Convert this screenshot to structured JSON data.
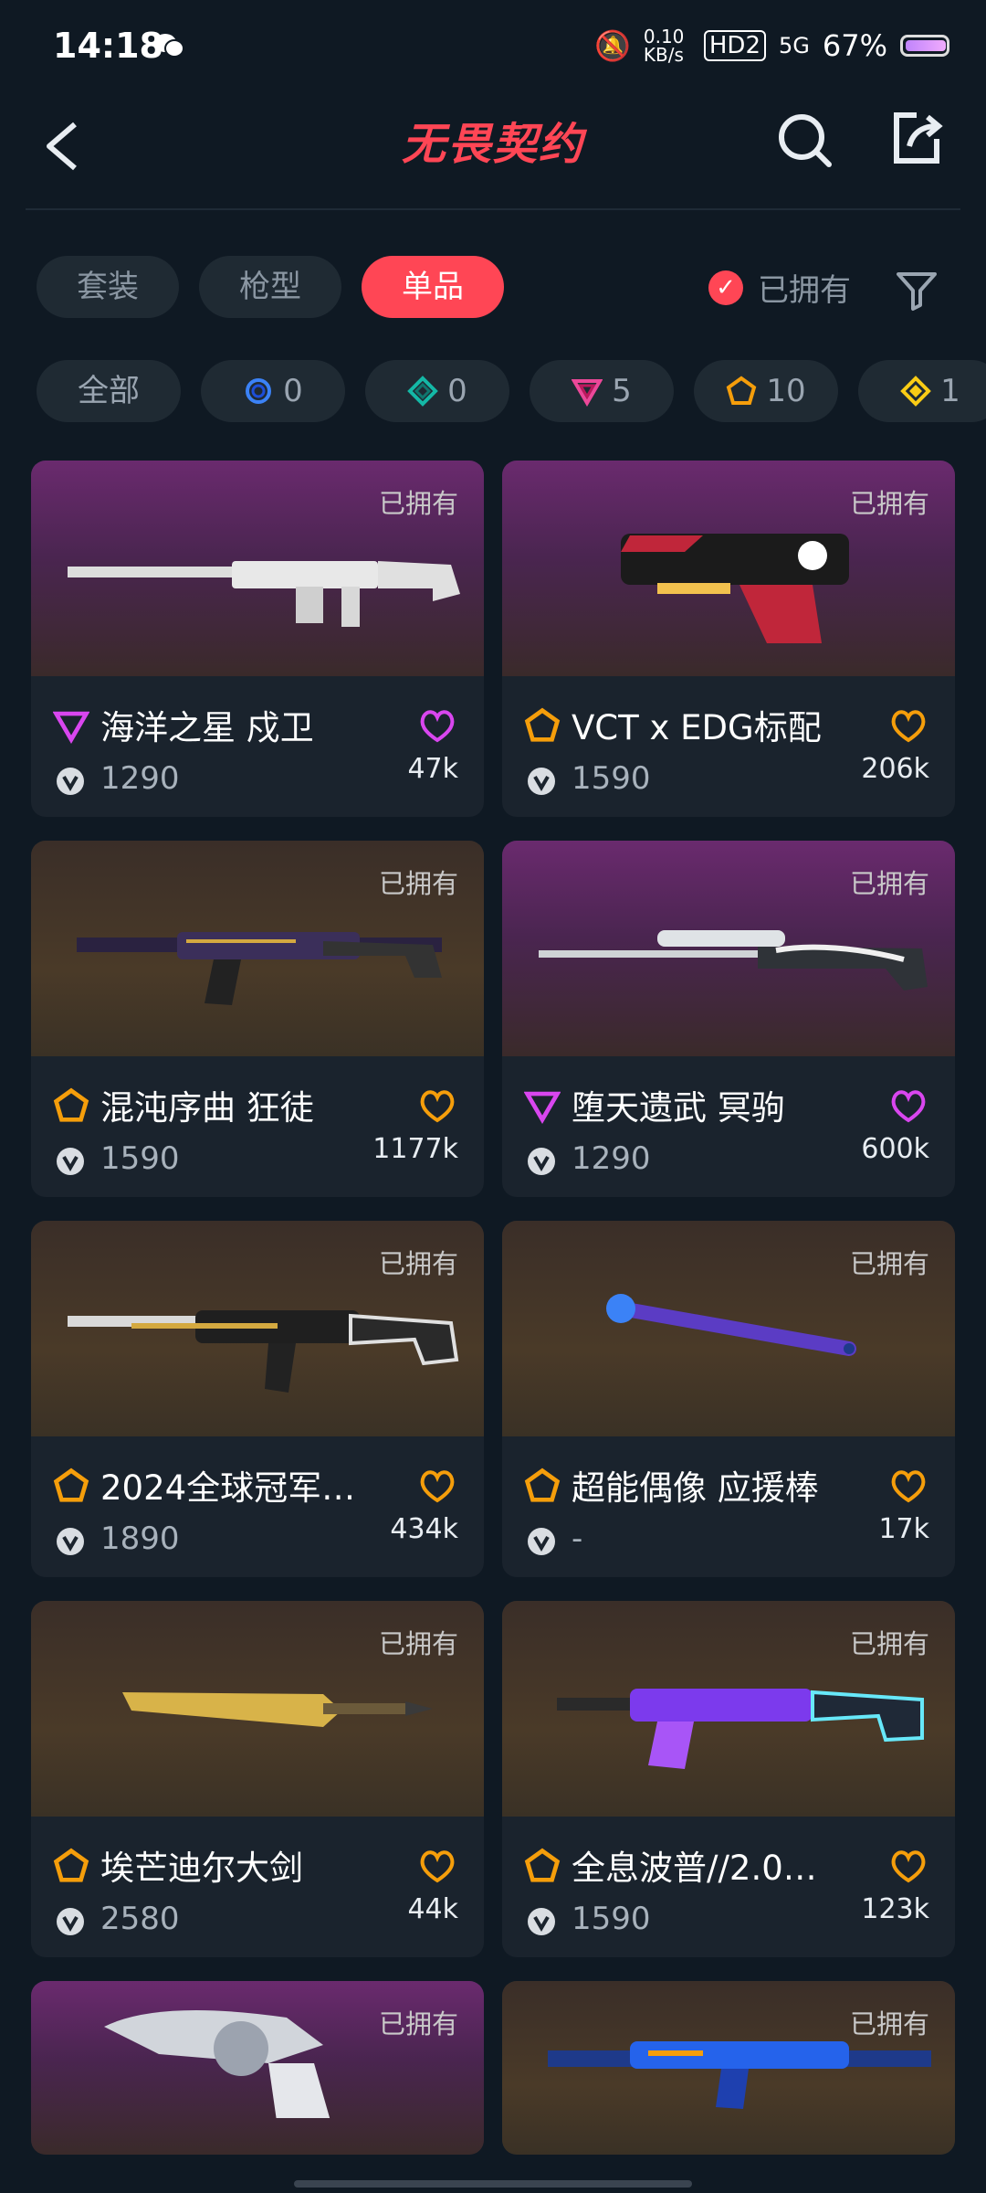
{
  "status_bar": {
    "time": "14:18",
    "net_speed": "0.10 KB/s",
    "hd": "HD2",
    "signal": "5G",
    "battery": "67%"
  },
  "header": {
    "logo_text": "无畏契约"
  },
  "tabs": [
    {
      "label": "套装"
    },
    {
      "label": "枪型"
    },
    {
      "label": "单品",
      "active": true
    }
  ],
  "owned_filter": {
    "label": "已拥有",
    "checked": true
  },
  "tiers": [
    {
      "label": "全部"
    },
    {
      "label": "0",
      "color": "#3b82f6"
    },
    {
      "label": "0",
      "color": "#14b8a6"
    },
    {
      "label": "5",
      "color": "#ec4899"
    },
    {
      "label": "10",
      "color": "#f59e0b"
    },
    {
      "label": "1",
      "color": "#facc15"
    }
  ],
  "items": [
    {
      "owned": "已拥有",
      "name": "海洋之星 戍卫",
      "price": "1290",
      "likes": "47k",
      "tier_color": "#d946ef",
      "bg": "purple"
    },
    {
      "owned": "已拥有",
      "name": "VCT x EDG标配",
      "price": "1590",
      "likes": "206k",
      "tier_color": "#f59e0b",
      "bg": "purple"
    },
    {
      "owned": "已拥有",
      "name": "混沌序曲 狂徒",
      "price": "1590",
      "likes": "1177k",
      "tier_color": "#f59e0b",
      "bg": "gold"
    },
    {
      "owned": "已拥有",
      "name": "堕天遗武 冥驹",
      "price": "1290",
      "likes": "600k",
      "tier_color": "#d946ef",
      "bg": "purple"
    },
    {
      "owned": "已拥有",
      "name": "2024全球冠军…",
      "price": "1890",
      "likes": "434k",
      "tier_color": "#f59e0b",
      "bg": "gold"
    },
    {
      "owned": "已拥有",
      "name": "超能偶像 应援棒",
      "price": "-",
      "likes": "17k",
      "tier_color": "#f59e0b",
      "bg": "gold"
    },
    {
      "owned": "已拥有",
      "name": "埃芒迪尔大剑",
      "price": "2580",
      "likes": "44k",
      "tier_color": "#f59e0b",
      "bg": "gold"
    },
    {
      "owned": "已拥有",
      "name": "全息波普//2.0…",
      "price": "1590",
      "likes": "123k",
      "tier_color": "#f59e0b",
      "bg": "gold"
    },
    {
      "owned": "已拥有",
      "name": "",
      "price": "",
      "likes": "",
      "tier_color": "#d946ef",
      "bg": "purple"
    },
    {
      "owned": "已拥有",
      "name": "",
      "price": "",
      "likes": "",
      "tier_color": "#f59e0b",
      "bg": "gold"
    }
  ],
  "colors": {
    "accent": "#ff4655",
    "background": "#0f1923",
    "card": "#1a232d"
  }
}
